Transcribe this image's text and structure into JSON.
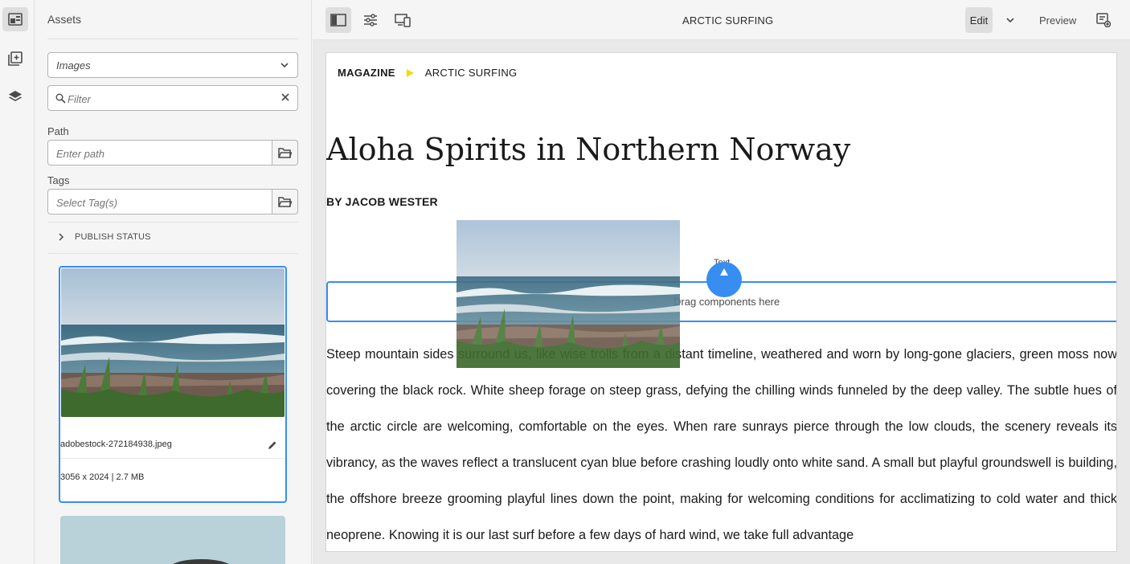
{
  "rail": {
    "items": [
      {
        "name": "assets",
        "icon": "assets-icon",
        "active": true
      },
      {
        "name": "components",
        "icon": "components-icon",
        "active": false
      },
      {
        "name": "content-tree",
        "icon": "layers-icon",
        "active": false
      }
    ]
  },
  "panel": {
    "title": "Assets",
    "type_select": {
      "value": "Images"
    },
    "filter": {
      "placeholder": "Filter"
    },
    "path": {
      "label": "Path",
      "placeholder": "Enter path"
    },
    "tags": {
      "label": "Tags",
      "placeholder": "Select Tag(s)"
    },
    "publish_status": {
      "label": "PUBLISH STATUS"
    },
    "assets": [
      {
        "filename": "adobestock-272184938.jpeg",
        "meta": "3056 x 2024 | 2.7 MB"
      }
    ]
  },
  "topbar": {
    "page_title": "ARCTIC SURFING",
    "mode": "Edit",
    "preview_label": "Preview"
  },
  "page": {
    "breadcrumb": [
      "MAGAZINE",
      "ARCTIC SURFING"
    ],
    "headline": "Aloha Spirits in Northern Norway",
    "byline": "BY JACOB WESTER",
    "drop_label": "Drag components here",
    "drag_component_label": "Text",
    "body": "Steep mountain sides surround us, like wise trolls from a distant timeline, weathered and worn by long-gone glaciers, green moss now covering the black rock. White sheep forage on steep grass, defying the chilling winds funneled by the deep valley. The subtle hues of the arctic circle are welcoming, comfortable on the eyes. When rare sunrays pierce through the low clouds, the scenery reveals its vibrancy, as the waves reflect a translucent cyan blue before crashing loudly onto white sand. A small but playful groundswell is building, the offshore breeze grooming playful lines down the point, making for welcoming conditions for acclimatizing to cold water and thick neoprene. Knowing it is our last surf before a few days of hard wind, we take full advantage"
  },
  "colors": {
    "accent": "#378ef0",
    "breadcrumb_marker": "#f5d90a"
  }
}
